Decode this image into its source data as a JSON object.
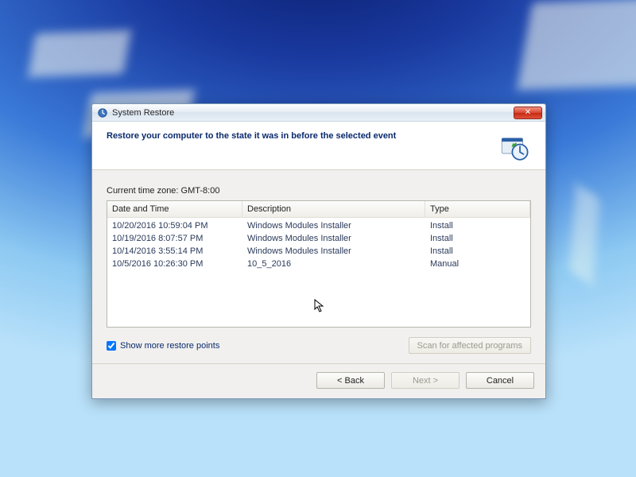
{
  "window": {
    "title": "System Restore",
    "close_glyph": "✕"
  },
  "header": {
    "headline": "Restore your computer to the state it was in before the selected event"
  },
  "timezone_label": "Current time zone: GMT-8:00",
  "columns": {
    "datetime": "Date and Time",
    "description": "Description",
    "type": "Type"
  },
  "restore_points": [
    {
      "datetime": "10/20/2016 10:59:04 PM",
      "description": "Windows Modules Installer",
      "type": "Install"
    },
    {
      "datetime": "10/19/2016 8:07:57 PM",
      "description": "Windows Modules Installer",
      "type": "Install"
    },
    {
      "datetime": "10/14/2016 3:55:14 PM",
      "description": "Windows Modules Installer",
      "type": "Install"
    },
    {
      "datetime": "10/5/2016 10:26:30 PM",
      "description": "10_5_2016",
      "type": "Manual"
    }
  ],
  "show_more": {
    "label": "Show more restore points",
    "checked": true
  },
  "buttons": {
    "scan": "Scan for affected programs",
    "back": "< Back",
    "next": "Next >",
    "cancel": "Cancel"
  }
}
